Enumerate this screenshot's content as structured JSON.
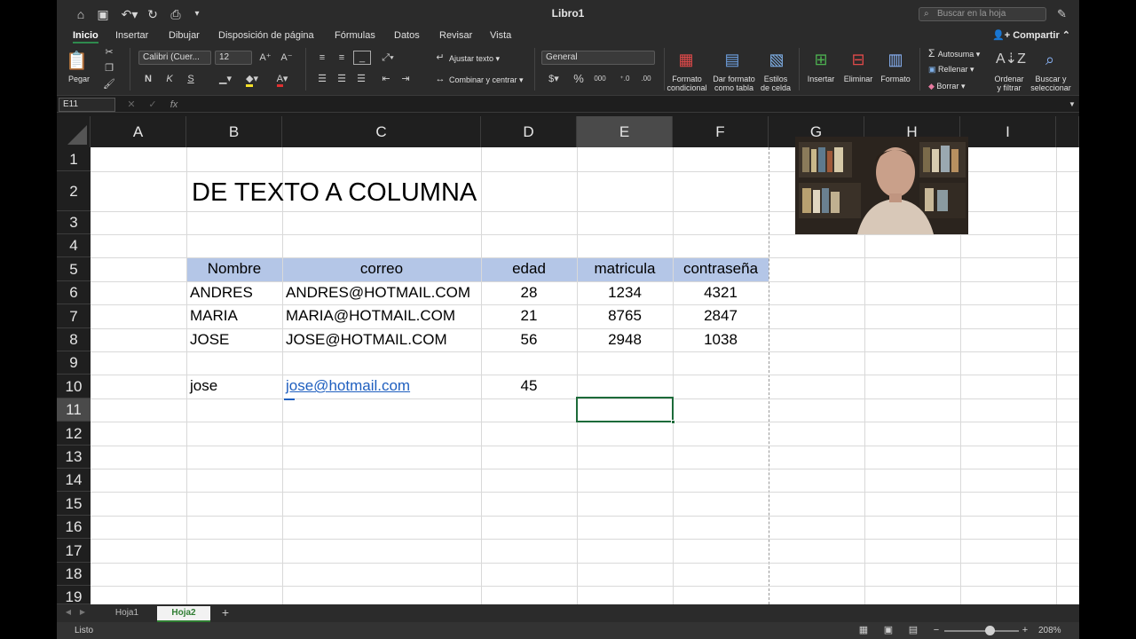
{
  "window": {
    "title": "Libro1",
    "search_placeholder": "Buscar en la hoja"
  },
  "tabs": [
    "Inicio",
    "Insertar",
    "Dibujar",
    "Disposición de página",
    "Fórmulas",
    "Datos",
    "Revisar",
    "Vista"
  ],
  "share_label": "Compartir",
  "ribbon": {
    "paste": "Pegar",
    "font_name": "Calibri (Cuer...",
    "font_size": "12",
    "bold": "N",
    "italic": "K",
    "underline": "S",
    "wrap_text": "Ajustar texto",
    "merge_center": "Combinar y centrar",
    "number_format": "General",
    "conditional_format": [
      "Formato",
      "condicional"
    ],
    "format_table": [
      "Dar formato",
      "como tabla"
    ],
    "cell_styles": [
      "Estilos",
      "de celda"
    ],
    "insert": "Insertar",
    "delete": "Eliminar",
    "format": "Formato",
    "autosum": "Autosuma",
    "fill": "Rellenar",
    "clear": "Borrar",
    "sort_filter": [
      "Ordenar",
      "y filtrar"
    ],
    "find_select": [
      "Buscar y",
      "seleccionar"
    ]
  },
  "formula_bar": {
    "name_box": "E11",
    "fx": "fx",
    "content": ""
  },
  "columns": [
    "A",
    "B",
    "C",
    "D",
    "E",
    "F",
    "G",
    "H",
    "I"
  ],
  "rows": [
    "1",
    "2",
    "3",
    "4",
    "5",
    "6",
    "7",
    "8",
    "9",
    "10",
    "11",
    "12",
    "13",
    "14",
    "15",
    "16",
    "17",
    "18",
    "19"
  ],
  "selected_cell": {
    "column": "E",
    "row": "11"
  },
  "sheet": {
    "title": "DE TEXTO A COLUMNA",
    "headers": [
      "Nombre",
      "correo",
      "edad",
      "matricula",
      "contraseña"
    ],
    "records": [
      [
        "ANDRES",
        "ANDRES@HOTMAIL.COM",
        "28",
        "1234",
        "4321"
      ],
      [
        "MARIA",
        "MARIA@HOTMAIL.COM",
        "21",
        "8765",
        "2847"
      ],
      [
        "JOSE",
        "JOSE@HOTMAIL.COM",
        "56",
        "2948",
        "1038"
      ]
    ],
    "row10": [
      "jose",
      "jose@hotmail.com",
      "45"
    ]
  },
  "sheet_tabs": [
    "Hoja1",
    "Hoja2"
  ],
  "active_sheet": "Hoja2",
  "status": {
    "text": "Listo",
    "zoom": "208%"
  },
  "colors": {
    "accent": "#217346",
    "header_band": "#b4c6e7",
    "link": "#1f5fbf"
  }
}
